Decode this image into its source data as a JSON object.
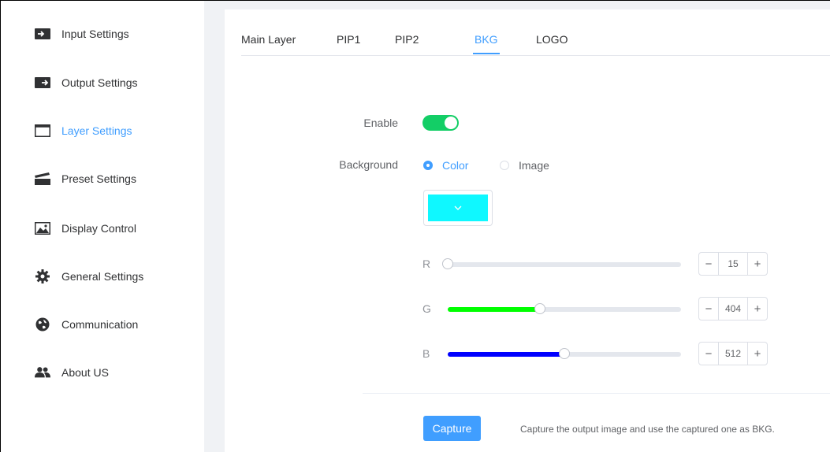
{
  "sidebar": {
    "items": [
      {
        "label": "Input Settings",
        "icon": "input-icon"
      },
      {
        "label": "Output Settings",
        "icon": "output-icon"
      },
      {
        "label": "Layer Settings",
        "icon": "layer-window-icon",
        "active": true
      },
      {
        "label": "Preset Settings",
        "icon": "preset-clapper-icon"
      },
      {
        "label": "Display Control",
        "icon": "image-icon"
      },
      {
        "label": "General Settings",
        "icon": "gear-icon"
      },
      {
        "label": "Communication",
        "icon": "globe-icon"
      },
      {
        "label": "About US",
        "icon": "users-icon"
      }
    ]
  },
  "tabs": [
    {
      "label": "Main Layer"
    },
    {
      "label": "PIP1"
    },
    {
      "label": "PIP2"
    },
    {
      "label": "BKG",
      "active": true
    },
    {
      "label": "LOGO"
    }
  ],
  "form": {
    "enable_label": "Enable",
    "enable_value": true,
    "background_label": "Background",
    "background_options": [
      "Color",
      "Image"
    ],
    "background_selected": "Color",
    "color_value": "#0ff8ff"
  },
  "rgb": {
    "r": {
      "label": "R",
      "value": "15",
      "fraction": 0.0,
      "fill": "#e4e7ed"
    },
    "g": {
      "label": "G",
      "value": "404",
      "fraction": 0.395,
      "fill": "#00ff00"
    },
    "b": {
      "label": "B",
      "value": "512",
      "fraction": 0.5,
      "fill": "#0000ff"
    }
  },
  "capture": {
    "button_label": "Capture",
    "hint": "Capture the output image and use the captured one as BKG."
  },
  "colors": {
    "accent": "#409eff",
    "switch_on": "#13ce66"
  }
}
